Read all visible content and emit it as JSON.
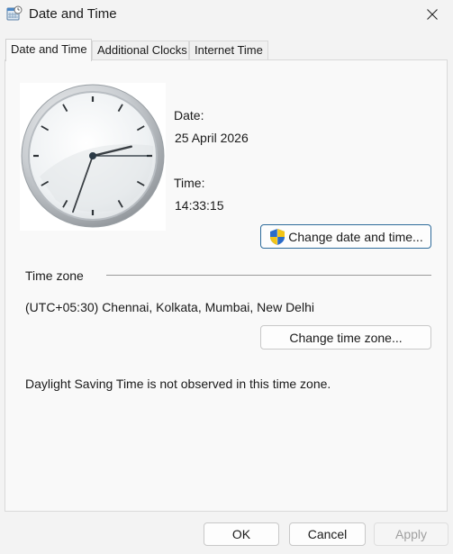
{
  "window": {
    "title": "Date and Time",
    "icon": "calendar-clock-icon",
    "close_icon": "close-icon"
  },
  "tabs": [
    {
      "label": "Date and Time",
      "active": true
    },
    {
      "label": "Additional Clocks",
      "active": false
    },
    {
      "label": "Internet Time",
      "active": false
    }
  ],
  "clock": {
    "hour": 14,
    "minute": 33,
    "second": 15
  },
  "date": {
    "label": "Date:",
    "value": "25 April 2026"
  },
  "time": {
    "label": "Time:",
    "value": "14:33:15"
  },
  "change_date_button": {
    "label": "Change date and time...",
    "icon": "uac-shield-icon"
  },
  "timezone": {
    "group_label": "Time zone",
    "value": "(UTC+05:30) Chennai, Kolkata, Mumbai, New Delhi",
    "change_button": "Change time zone..."
  },
  "dst_note": "Daylight Saving Time is not observed in this time zone.",
  "footer": {
    "ok": "OK",
    "cancel": "Cancel",
    "apply": "Apply",
    "apply_enabled": false
  }
}
